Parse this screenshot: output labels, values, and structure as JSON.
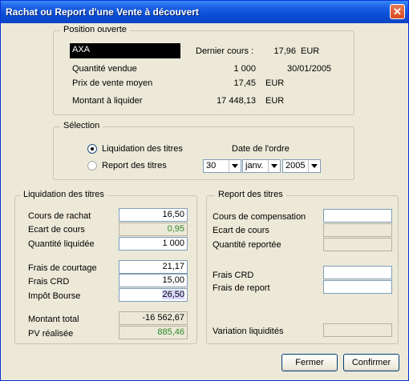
{
  "window": {
    "title": "Rachat ou Report d'une Vente à découvert",
    "close_symbol": "✕"
  },
  "position": {
    "label": "Position ouverte",
    "symbol": "AXA",
    "dernier_cours_label": "Dernier cours :",
    "dernier_cours_value": "17,96",
    "dernier_cours_currency": "EUR",
    "quantite_label": "Quantité vendue",
    "quantite_value": "1 000",
    "quantite_date": "30/01/2005",
    "prix_label": "Prix de vente moyen",
    "prix_value": "17,45",
    "prix_currency": "EUR",
    "montant_label": "Montant à liquider",
    "montant_value": "17 448,13",
    "montant_currency": "EUR"
  },
  "selection": {
    "label": "Sélection",
    "option_liquidation": "Liquidation des titres",
    "option_report": "Report des titres",
    "selected": "liquidation",
    "date_label": "Date de l'ordre",
    "day": "30",
    "month": "janv.",
    "year": "2005"
  },
  "liquidation": {
    "label": "Liquidation des titres",
    "cours_rachat_label": "Cours de rachat",
    "cours_rachat_value": "16,50",
    "ecart_label": "Ecart de cours",
    "ecart_value": "0,95",
    "quantite_label": "Quantité liquidée",
    "quantite_value": "1 000",
    "frais_courtage_label": "Frais de courtage",
    "frais_courtage_value": "21,17",
    "frais_crd_label": "Frais CRD",
    "frais_crd_value": "15,00",
    "impot_label": "Impôt Bourse",
    "impot_value": "26,50",
    "montant_total_label": "Montant total",
    "montant_total_value": "-16 562,67",
    "pv_label": "PV réalisée",
    "pv_value": "885,46"
  },
  "report": {
    "label": "Report des titres",
    "cours_comp_label": "Cours de compensation",
    "ecart_label": "Ecart de cours",
    "quantite_label": "Quantité reportée",
    "frais_crd_label": "Frais CRD",
    "frais_report_label": "Frais de report",
    "variation_label": "Variation liquidités"
  },
  "buttons": {
    "fermer": "Fermer",
    "confirmer": "Confirmer"
  },
  "colors": {
    "titlebar": "#0a4fd6",
    "positive_value": "#2a8a2a",
    "background": "#ece9d8"
  }
}
